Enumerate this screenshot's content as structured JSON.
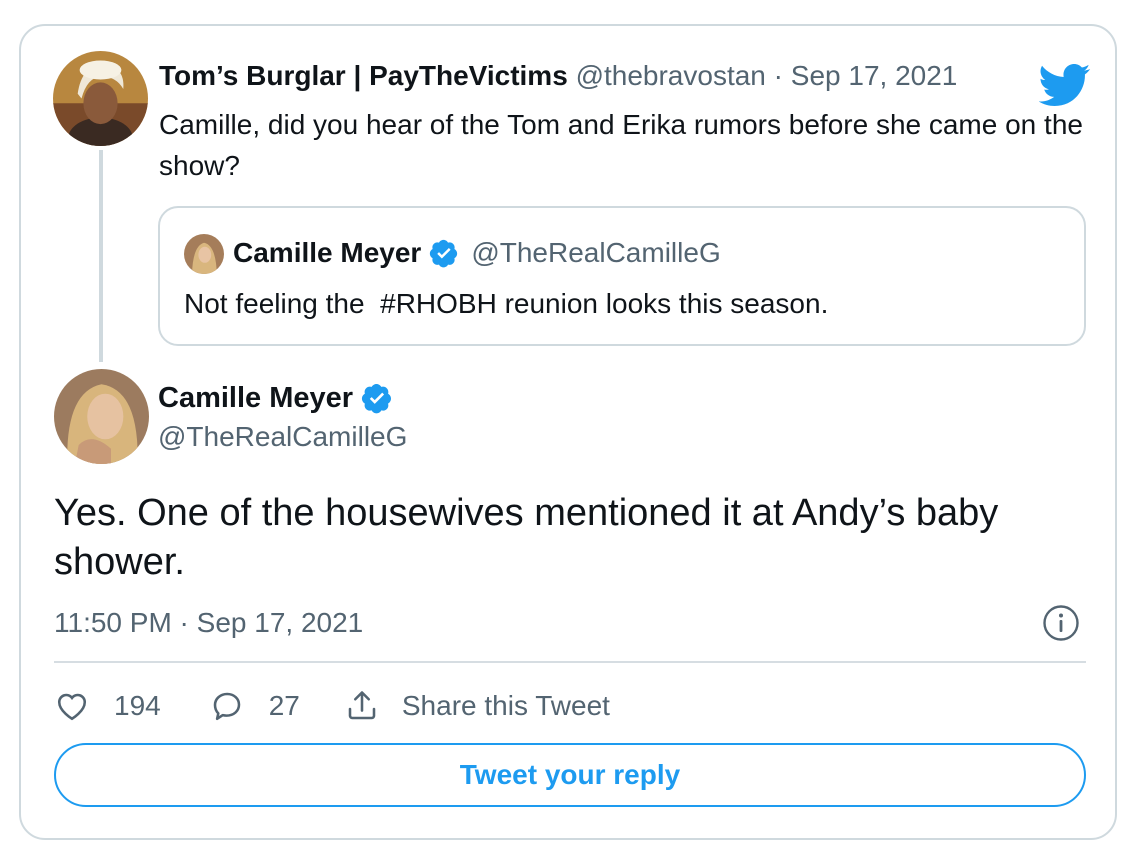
{
  "reply_tweet": {
    "author_name": "Tom’s Burglar | PayTheVictims",
    "handle": "@thebravostan",
    "separator": " · ",
    "date": "Sep 17, 2021",
    "text": "Camille, did you hear of the Tom and Erika rumors before she came on the show?",
    "avatar_icon": "avatar-platinum-blonde",
    "logo_icon": "twitter-bird-icon"
  },
  "quoted_tweet": {
    "author_name": "Camille Meyer",
    "verified_icon": "verified-badge-icon",
    "handle": "@TheRealCamilleG",
    "text": "Not feeling the  #RHOBH reunion looks this season."
  },
  "main_tweet": {
    "author_name": "Camille Meyer",
    "verified_icon": "verified-badge-icon",
    "handle": "@TheRealCamilleG",
    "text": "Yes. One of the housewives mentioned it at Andy’s baby shower.",
    "timestamp": "11:50 PM · Sep 17, 2021",
    "info_icon": "info-icon"
  },
  "actions": {
    "likes": "194",
    "replies": "27",
    "share_label": "Share this Tweet",
    "like_icon": "heart-icon",
    "reply_icon": "speech-bubble-icon",
    "share_icon": "share-upload-icon"
  },
  "reply_button": {
    "label": "Tweet your reply"
  },
  "colors": {
    "brand_blue": "#1d9bf0",
    "text": "#0f1419",
    "muted": "#536471",
    "border": "#cfd9de"
  }
}
